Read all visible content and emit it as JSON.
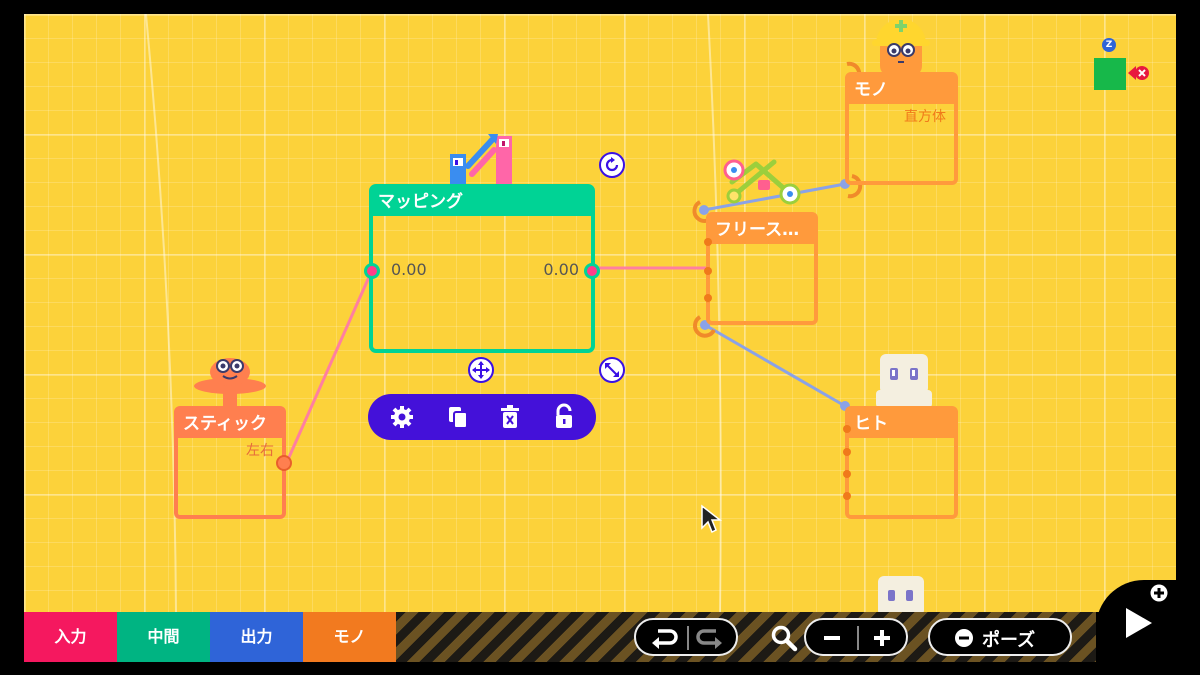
{
  "nodes": {
    "stick": {
      "title": "スティック",
      "sub": "左右"
    },
    "mapping": {
      "title": "マッピング",
      "in_value": "0.00",
      "out_value": "0.00"
    },
    "freeze": {
      "title": "フリース…"
    },
    "mono": {
      "title": "モノ",
      "sub": "直方体"
    },
    "hito": {
      "title": "ヒト"
    }
  },
  "toolbar": {
    "settings": "gear-icon",
    "copy": "copy-icon",
    "delete": "delete-icon",
    "lock": "lock-icon"
  },
  "categories": [
    {
      "label": "入力",
      "color": "#f5185f"
    },
    {
      "label": "中間",
      "color": "#00b482"
    },
    {
      "label": "出力",
      "color": "#2f64d8"
    },
    {
      "label": "モノ",
      "color": "#f27a1f"
    }
  ],
  "controls": {
    "pause_label": "ポーズ",
    "undo_icon": "undo-icon",
    "redo_icon": "redo-icon",
    "zoom_icon": "magnifier-icon",
    "zoom_out": "minus-icon",
    "zoom_in": "plus-icon",
    "play_icon": "play-icon"
  },
  "minimap": {
    "marker": "Z"
  },
  "colors": {
    "canvas": "#fcd23a",
    "mapping": "#00d395",
    "node_orange": "#ff9a3c",
    "stick": "#ff7f4f",
    "wire_pink": "#ff7fa0",
    "wire_blue": "#8aa2e8",
    "toolbar": "#4411d9"
  }
}
